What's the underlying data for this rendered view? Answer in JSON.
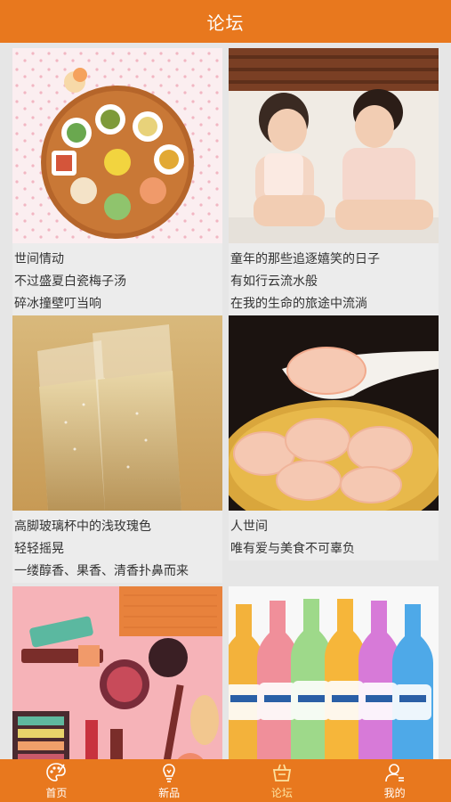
{
  "header": {
    "title": "论坛"
  },
  "posts": [
    {
      "lines": [
        "世间情动",
        "不过盛夏白瓷梅子汤",
        "碎冰撞壁叮当响"
      ]
    },
    {
      "lines": [
        "童年的那些追逐嬉笑的日子",
        "有如行云流水般",
        "在我的生命的旅途中流淌"
      ]
    },
    {
      "lines": [
        "高脚玻璃杯中的浅玫瑰色",
        "轻轻摇晃",
        "一缕醇香、果香、清香扑鼻而来"
      ]
    },
    {
      "lines": [
        "人世间",
        "唯有爱与美食不可辜负"
      ]
    },
    {
      "lines": []
    },
    {
      "lines": []
    }
  ],
  "tabbar": {
    "items": [
      {
        "label": "首页",
        "icon": "palette-icon",
        "active": false
      },
      {
        "label": "新品",
        "icon": "lightbulb-icon",
        "active": false
      },
      {
        "label": "论坛",
        "icon": "basket-icon",
        "active": true
      },
      {
        "label": "我的",
        "icon": "user-icon",
        "active": false
      }
    ]
  },
  "colors": {
    "accent": "#e8781e",
    "active_tab": "#fde3a0"
  }
}
